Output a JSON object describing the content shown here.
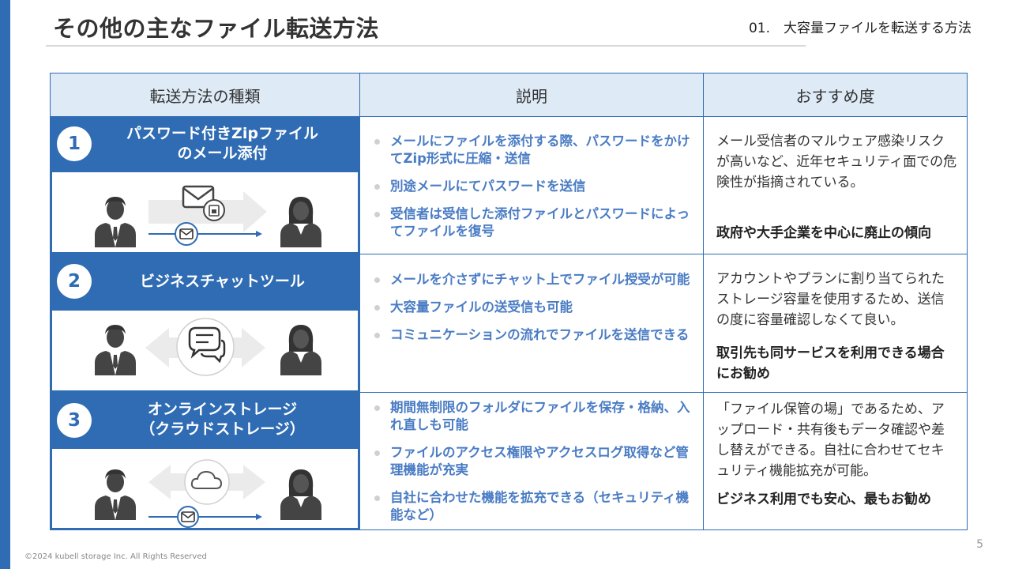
{
  "slide": {
    "title": "その他の主なファイル転送方法",
    "section": "01.　大容量ファイルを転送する方法",
    "page_number": "5",
    "copyright": "©2024 kubell storage Inc. All Rights Reserved",
    "accent_color": "#2f6cb3",
    "header_bg_color": "#deeaf6"
  },
  "table": {
    "headers": [
      "転送方法の種類",
      "説明",
      "おすすめ度"
    ],
    "rows": [
      {
        "number": "1",
        "name_line1": "パスワード付きZipファイル",
        "name_line2": "のメール添付",
        "illustration_icons": [
          "businessman-icon",
          "envelope-icon",
          "locked-file-icon",
          "mail-circle-icon",
          "arrow-right-icon",
          "businesswoman-icon"
        ],
        "bullets": [
          "メールにファイルを添付する際、パスワードをかけてZip形式に圧縮・送信",
          "別途メールにてパスワードを送信",
          "受信者は受信した添付ファイルとパスワードによってファイルを復号"
        ],
        "recommendation": "メール受信者のマルウェア感染リスクが高いなど、近年セキュリティ面での危険性が指摘されている。",
        "recommendation_strong": "政府や大手企業を中心に廃止の傾向"
      },
      {
        "number": "2",
        "name_line1": "ビジネスチャットツール",
        "name_line2": "",
        "illustration_icons": [
          "businessman-icon",
          "chat-bubbles-icon",
          "double-arrow-icon",
          "businesswoman-icon"
        ],
        "bullets": [
          "メールを介さずにチャット上でファイル授受が可能",
          "大容量ファイルの送受信も可能",
          "コミュニケーションの流れでファイルを送信できる"
        ],
        "recommendation": "アカウントやプランに割り当てられたストレージ容量を使用するため、送信の度に容量確認しなくて良い。",
        "recommendation_strong": "取引先も同サービスを利用できる場合にお勧め"
      },
      {
        "number": "3",
        "name_line1": "オンラインストレージ",
        "name_line2": "（クラウドストレージ）",
        "illustration_icons": [
          "businessman-icon",
          "cloud-icon",
          "double-arrow-icon",
          "mail-circle-icon",
          "arrow-right-icon",
          "businesswoman-icon"
        ],
        "bullets": [
          "期間無制限のフォルダにファイルを保存・格納、入れ直しも可能",
          "ファイルのアクセス権限やアクセスログ取得など管理機能が充実",
          "自社に合わせた機能を拡充できる（セキュリティ機能など）"
        ],
        "recommendation": "「ファイル保管の場」であるため、アップロード・共有後もデータ確認や差し替えができる。自社に合わせてセキュリティ機能拡充が可能。",
        "recommendation_strong": "ビジネス利用でも安心、最もお勧め"
      }
    ]
  }
}
